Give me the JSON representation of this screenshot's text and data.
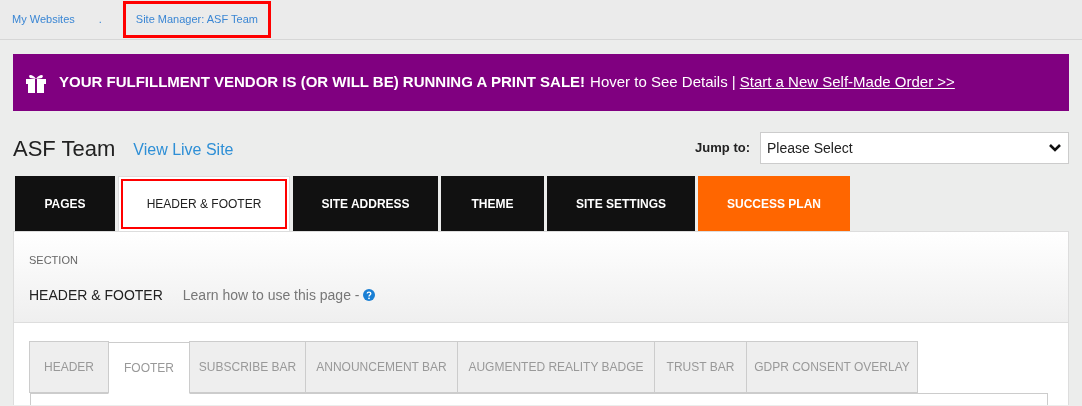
{
  "breadcrumbs": [
    {
      "label": "My Websites",
      "highlighted": false
    },
    {
      "label": ".",
      "highlighted": false
    },
    {
      "label": "Site Manager: ASF Team",
      "highlighted": true
    }
  ],
  "banner": {
    "headline": "YOUR FULFILLMENT VENDOR IS (OR WILL BE) RUNNING A PRINT SALE!",
    "hint": "Hover to See Details |",
    "link": "Start a New Self-Made Order >>"
  },
  "site": {
    "title": "ASF Team",
    "live_link": "View Live Site"
  },
  "jump_to": {
    "label": "Jump to:",
    "value": "Please Select"
  },
  "tabs": [
    {
      "label": "PAGES",
      "kind": "dark",
      "selected": false,
      "highlighted": false
    },
    {
      "label": "HEADER & FOOTER",
      "kind": "dark",
      "selected": true,
      "highlighted": true
    },
    {
      "label": "SITE ADDRESS",
      "kind": "dark",
      "selected": false,
      "highlighted": false
    },
    {
      "label": "THEME",
      "kind": "dark",
      "selected": false,
      "highlighted": false
    },
    {
      "label": "SITE SETTINGS",
      "kind": "dark",
      "selected": false,
      "highlighted": false
    },
    {
      "label": "SUCCESS PLAN",
      "kind": "accent",
      "selected": false,
      "highlighted": false
    }
  ],
  "section": {
    "label": "SECTION",
    "title": "HEADER & FOOTER",
    "help": "Learn how to use this page -"
  },
  "subtabs": [
    {
      "label": "HEADER",
      "selected": false
    },
    {
      "label": "FOOTER",
      "selected": true
    },
    {
      "label": "SUBSCRIBE BAR",
      "selected": false
    },
    {
      "label": "ANNOUNCEMENT BAR",
      "selected": false
    },
    {
      "label": "AUGMENTED REALITY BADGE",
      "selected": false
    },
    {
      "label": "TRUST BAR",
      "selected": false
    },
    {
      "label": "GDPR CONSENT OVERLAY",
      "selected": false
    }
  ]
}
